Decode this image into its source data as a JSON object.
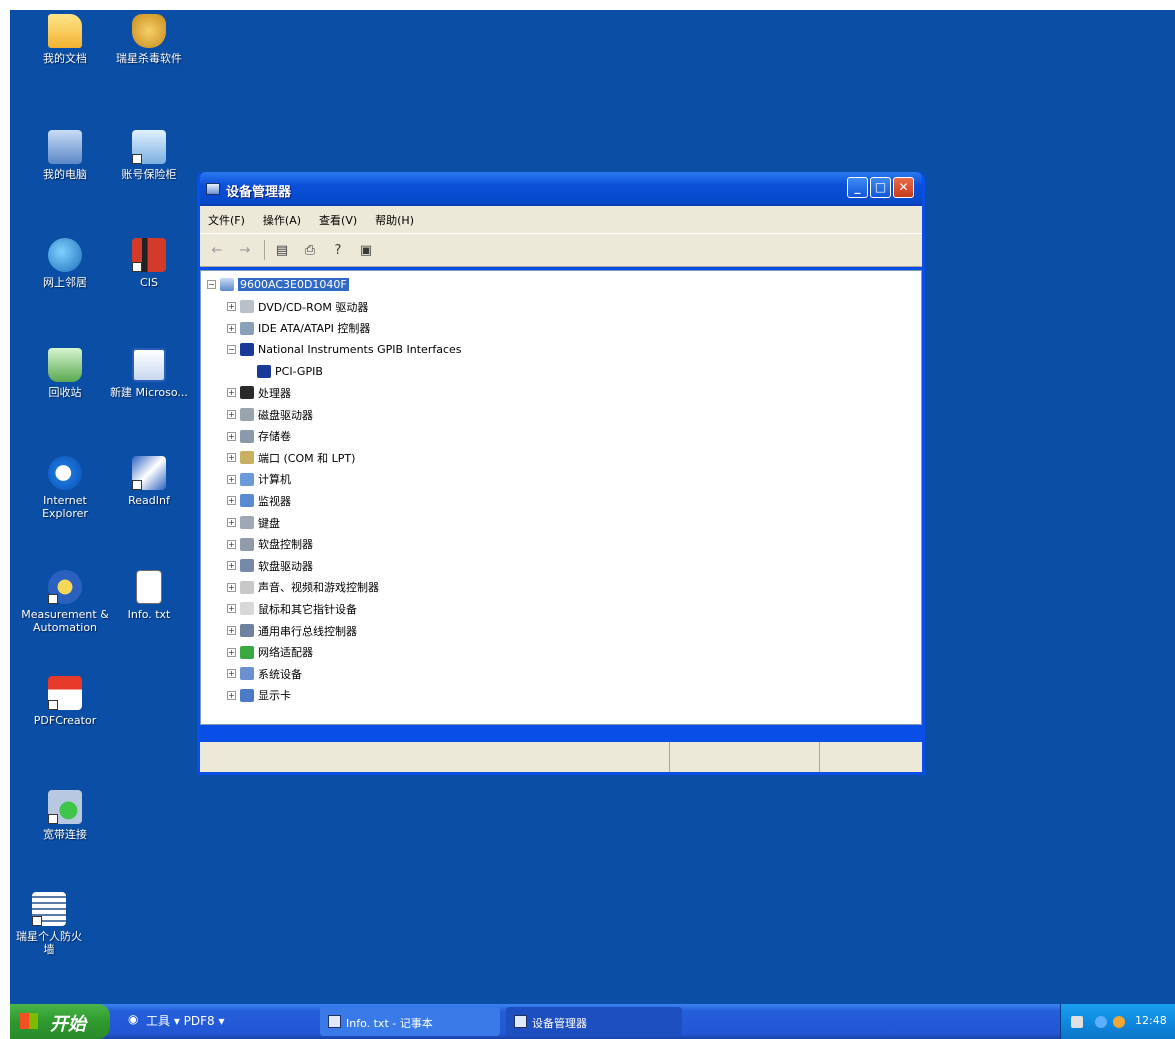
{
  "desktop": {
    "background_color": "#0a4ea6",
    "icons": [
      {
        "label": "我的文档",
        "icon": "my-documents-icon"
      },
      {
        "label": "瑞星杀毒软件",
        "icon": "rising-antivirus-icon"
      },
      {
        "label": "我的电脑",
        "icon": "my-computer-icon"
      },
      {
        "label": "账号保险柜",
        "icon": "account-safe-icon"
      },
      {
        "label": "网上邻居",
        "icon": "network-places-icon"
      },
      {
        "label": "CIS",
        "icon": "cis-icon"
      },
      {
        "label": "回收站",
        "icon": "recycle-bin-icon"
      },
      {
        "label": "新建 Microso...",
        "icon": "word-document-icon"
      },
      {
        "label": "Internet Explorer",
        "icon": "internet-explorer-icon"
      },
      {
        "label": "ReadInf",
        "icon": "readinf-icon"
      },
      {
        "label": "Measurement & Automation",
        "icon": "ni-max-icon"
      },
      {
        "label": "Info. txt",
        "icon": "text-file-icon"
      },
      {
        "label": "PDFCreator",
        "icon": "pdfcreator-icon"
      },
      {
        "label": "宽带连接",
        "icon": "broadband-connection-icon"
      },
      {
        "label": "瑞星个人防火墙",
        "icon": "rising-firewall-icon"
      }
    ]
  },
  "window": {
    "title": "设备管理器",
    "menu": [
      "文件(F)",
      "操作(A)",
      "查看(V)",
      "帮助(H)"
    ],
    "toolbar": [
      "back-arrow-icon",
      "forward-arrow-icon",
      "properties-icon",
      "print-icon",
      "help-icon",
      "scan-hardware-icon"
    ],
    "tree": {
      "root": "9600AC3E0D1040F",
      "nodes": [
        {
          "label": "DVD/CD-ROM 驱动器",
          "expander": "+",
          "icon": "cdrom-icon"
        },
        {
          "label": "IDE ATA/ATAPI 控制器",
          "expander": "+",
          "icon": "ide-controller-icon"
        },
        {
          "label": "National Instruments GPIB Interfaces",
          "expander": "−",
          "icon": "ni-gpib-icon"
        },
        {
          "label": "PCI-GPIB",
          "expander": "",
          "icon": "ni-gpib-icon",
          "child": true
        },
        {
          "label": "处理器",
          "expander": "+",
          "icon": "processor-icon"
        },
        {
          "label": "磁盘驱动器",
          "expander": "+",
          "icon": "disk-drive-icon"
        },
        {
          "label": "存储卷",
          "expander": "+",
          "icon": "storage-volume-icon"
        },
        {
          "label": "端口 (COM 和 LPT)",
          "expander": "+",
          "icon": "port-icon"
        },
        {
          "label": "计算机",
          "expander": "+",
          "icon": "computer-icon"
        },
        {
          "label": "监视器",
          "expander": "+",
          "icon": "monitor-icon"
        },
        {
          "label": "键盘",
          "expander": "+",
          "icon": "keyboard-icon"
        },
        {
          "label": "软盘控制器",
          "expander": "+",
          "icon": "floppy-controller-icon"
        },
        {
          "label": "软盘驱动器",
          "expander": "+",
          "icon": "floppy-drive-icon"
        },
        {
          "label": "声音、视频和游戏控制器",
          "expander": "+",
          "icon": "sound-icon"
        },
        {
          "label": "鼠标和其它指针设备",
          "expander": "+",
          "icon": "mouse-icon"
        },
        {
          "label": "通用串行总线控制器",
          "expander": "+",
          "icon": "usb-icon"
        },
        {
          "label": "网络适配器",
          "expander": "+",
          "icon": "network-adapter-icon"
        },
        {
          "label": "系统设备",
          "expander": "+",
          "icon": "system-device-icon"
        },
        {
          "label": "显示卡",
          "expander": "+",
          "icon": "display-adapter-icon"
        }
      ]
    }
  },
  "taskbar": {
    "start_label": "开始",
    "quicklaunch": "工具 ▾  PDF8 ▾",
    "tasks": [
      {
        "label": "Info. txt - 记事本"
      },
      {
        "label": "设备管理器"
      }
    ],
    "clock": "12:48"
  }
}
